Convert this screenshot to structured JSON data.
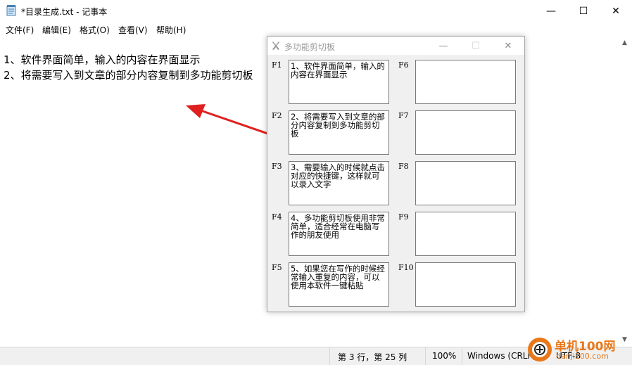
{
  "window": {
    "title": "*目录生成.txt - 记事本",
    "controls": {
      "minimize": "—",
      "maximize": "☐",
      "close": "✕"
    }
  },
  "menu": [
    {
      "label": "文件(F)"
    },
    {
      "label": "编辑(E)"
    },
    {
      "label": "格式(O)"
    },
    {
      "label": "查看(V)"
    },
    {
      "label": "帮助(H)"
    }
  ],
  "editor": {
    "lines": [
      "1、软件界面简单，输入的内容在界面显示",
      "2、将需要写入到文章的部分内容复制到多功能剪切板"
    ]
  },
  "statusbar": {
    "position": "第 3 行，第 25 列",
    "zoom": "100%",
    "encoding": "Windows (CRLF)",
    "charset": "UTF-8"
  },
  "clipboard": {
    "title": "多功能剪切板",
    "slots": [
      {
        "key": "F1",
        "text": "1、软件界面简单，输入的内容在界面显示"
      },
      {
        "key": "F2",
        "text": "2、将需要写入到文章的部分内容复制到多功能剪切板"
      },
      {
        "key": "F3",
        "text": "3、需要输入的时候就点击对应的快捷键，这样就可以录入文字"
      },
      {
        "key": "F4",
        "text": "4、多功能剪切板使用非常简单，适合经常在电脑写作的朋友使用"
      },
      {
        "key": "F5",
        "text": "5、如果您在写作的时候经常输入重复的内容，可以使用本软件一键粘贴"
      },
      {
        "key": "F6",
        "text": ""
      },
      {
        "key": "F7",
        "text": ""
      },
      {
        "key": "F8",
        "text": ""
      },
      {
        "key": "F9",
        "text": ""
      },
      {
        "key": "F10",
        "text": ""
      }
    ]
  },
  "watermark": {
    "name": "单机100网",
    "url": "danji100.com"
  },
  "colors": {
    "arrow": "#e02020",
    "watermark": "#e8781a"
  }
}
